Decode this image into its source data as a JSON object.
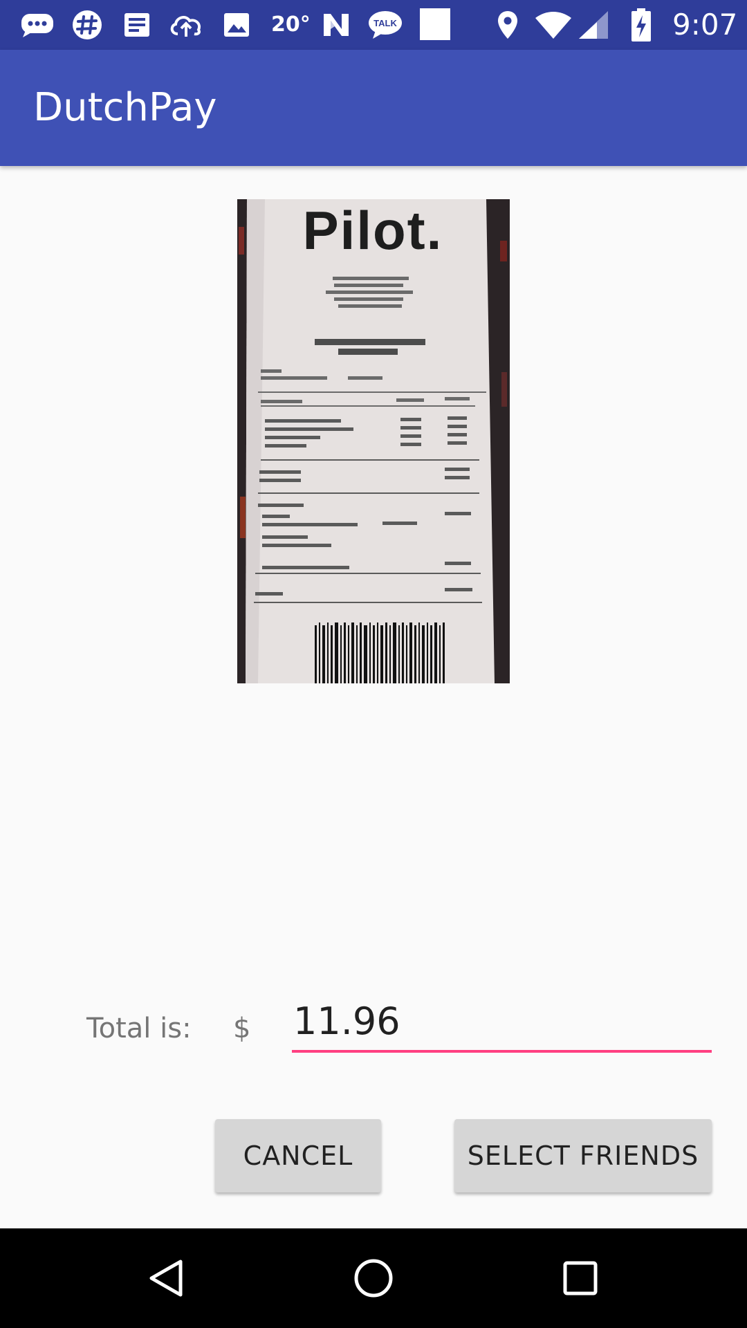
{
  "status_bar": {
    "temperature": "20°",
    "time": "9:07",
    "icons": [
      "messages-icon",
      "slack-icon",
      "news-icon",
      "cloud-upload-icon",
      "image-icon",
      "n-logo-icon",
      "talk-icon",
      "square-notification-icon",
      "location-icon",
      "wifi-icon",
      "cell-signal-icon",
      "battery-charging-icon"
    ],
    "talk_badge": "TALK"
  },
  "app_bar": {
    "title": "DutchPay",
    "color": "#3f51b5",
    "status_color": "#2f3d9a"
  },
  "receipt": {
    "brand": "Pilot."
  },
  "total": {
    "label": "Total is:",
    "currency": "$",
    "value": "11.96",
    "accent": "#ff4081"
  },
  "buttons": {
    "cancel": "CANCEL",
    "select_friends": "SELECT FRIENDS"
  },
  "nav_bar": {
    "icons": [
      "back-icon",
      "home-icon",
      "recents-icon"
    ]
  }
}
